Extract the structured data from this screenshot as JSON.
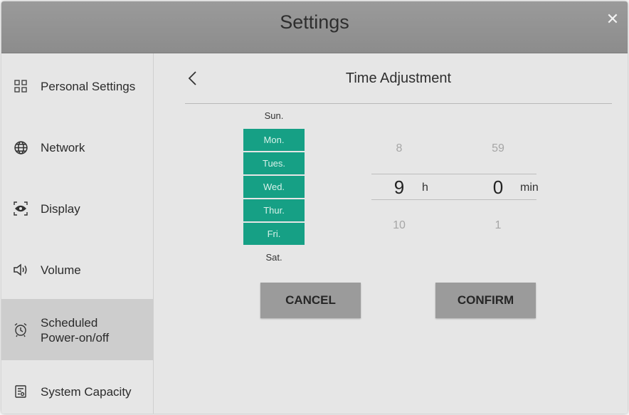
{
  "window": {
    "title": "Settings"
  },
  "sidebar": {
    "items": [
      {
        "label": "Personal Settings",
        "icon": "grid-icon"
      },
      {
        "label": "Network",
        "icon": "globe-icon"
      },
      {
        "label": "Display",
        "icon": "eye-icon"
      },
      {
        "label": "Volume",
        "icon": "speaker-icon"
      },
      {
        "label_line1": "Scheduled",
        "label_line2": "Power-on/off",
        "icon": "alarm-clock-icon",
        "active": true
      },
      {
        "label": "System Capacity",
        "icon": "storage-icon"
      }
    ]
  },
  "page": {
    "title": "Time Adjustment",
    "days": [
      {
        "label": "Sun.",
        "selected": false
      },
      {
        "label": "Mon.",
        "selected": true
      },
      {
        "label": "Tues.",
        "selected": true
      },
      {
        "label": "Wed.",
        "selected": true
      },
      {
        "label": "Thur.",
        "selected": true
      },
      {
        "label": "Fri.",
        "selected": true
      },
      {
        "label": "Sat.",
        "selected": false
      }
    ],
    "hour": {
      "prev": "8",
      "current": "9",
      "next": "10",
      "unit": "h"
    },
    "minute": {
      "prev": "59",
      "current": "0",
      "next": "1",
      "unit": "min"
    },
    "cancel_label": "CANCEL",
    "confirm_label": "CONFIRM"
  },
  "colors": {
    "accent": "#16a085",
    "titlebar": "#8f8f8f",
    "active_item": "#cdcdcd"
  }
}
